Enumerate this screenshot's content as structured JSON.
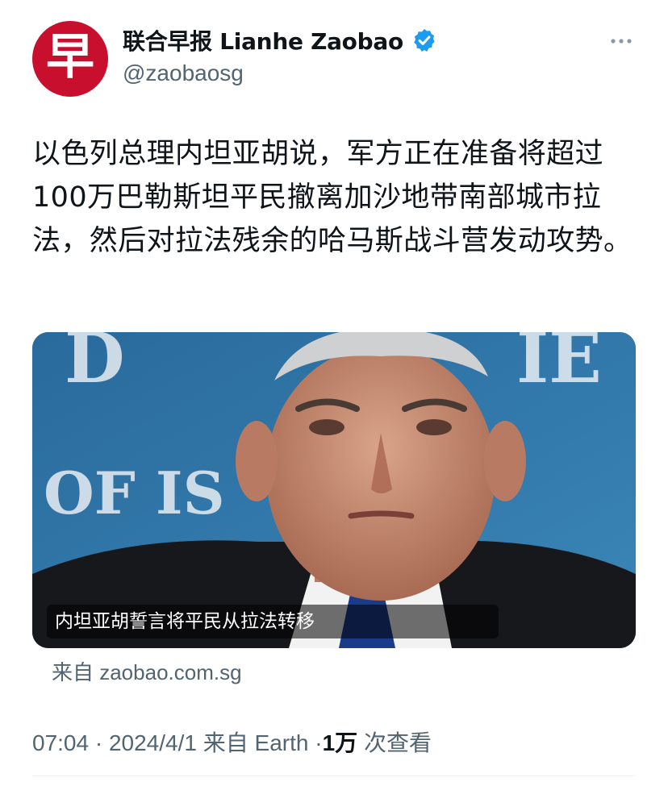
{
  "account": {
    "avatar_glyph": "早",
    "display_name": "联合早报 Lianhe Zaobao",
    "handle": "@zaobaosg",
    "brand_color": "#c8102e",
    "verified_color": "#1d9bf0"
  },
  "tweet": {
    "text": "以色列总理内坦亚胡说，军方正在准备将超过100万巴勒斯坦平民撤离加沙地带南部城市拉法，然后对拉法残余的哈马斯战斗营发动攻势。"
  },
  "link_card": {
    "image_caption": "内坦亚胡誓言将平民从拉法转移",
    "source": "来自 zaobao.com.sg",
    "image_backdrop_text": "OF IS"
  },
  "meta": {
    "time": "07:04",
    "separator": "·",
    "date": "2024/4/1",
    "via": "来自 Earth",
    "views_count": "1万",
    "views_label": "次查看"
  },
  "icons": {
    "more": "more-horizontal-icon",
    "verified": "verified-badge-icon"
  }
}
